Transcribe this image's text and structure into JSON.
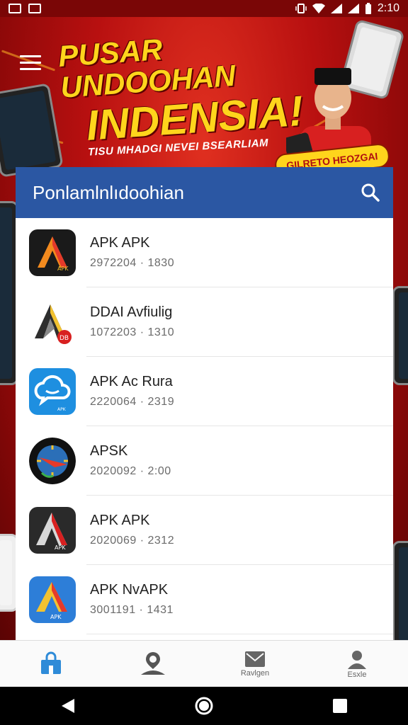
{
  "status_bar": {
    "time": "2:10"
  },
  "hero": {
    "title_line1": "PUSAR UNDOOHAN",
    "title_line2": "INDENSIA!",
    "subtitle": "TISU MHADGI NEVEI BSEARLIAM",
    "badge": "GILRETO HEOZGAI"
  },
  "card": {
    "title": "Ponlamlnlıdoohian",
    "items": [
      {
        "name": "APK APK",
        "meta": "2972204 · 1830",
        "icon": "apk-orange-a-icon",
        "icon_text": "APK"
      },
      {
        "name": "DDAI Avfiulig",
        "meta": "1072203 · 1310",
        "icon": "apk-grey-a-icon",
        "icon_text": "DB"
      },
      {
        "name": "APK Ac Rura",
        "meta": "2220064 · 2319",
        "icon": "chat-cloud-icon",
        "icon_text": "APK"
      },
      {
        "name": "APSK",
        "meta": "2020092 · 2:00",
        "icon": "compass-icon",
        "icon_text": ""
      },
      {
        "name": "APK APK",
        "meta": "2020069 · 2312",
        "icon": "apk-dark-a-icon",
        "icon_text": "APK"
      },
      {
        "name": "APK NvAPK",
        "meta": "3001191 · 1431",
        "icon": "apk-blue-a-icon",
        "icon_text": "APK"
      }
    ]
  },
  "bottom_nav": [
    {
      "label": "",
      "icon": "store-bag-icon"
    },
    {
      "label": "",
      "icon": "person-icon"
    },
    {
      "label": "Ravlgen",
      "icon": "mail-icon"
    },
    {
      "label": "Esxle",
      "icon": "profile-icon"
    }
  ],
  "colors": {
    "accent": "#2b57a3",
    "hero_red": "#b81010",
    "hero_yellow": "#ffd51c",
    "nav_active": "#2e8bd8"
  }
}
